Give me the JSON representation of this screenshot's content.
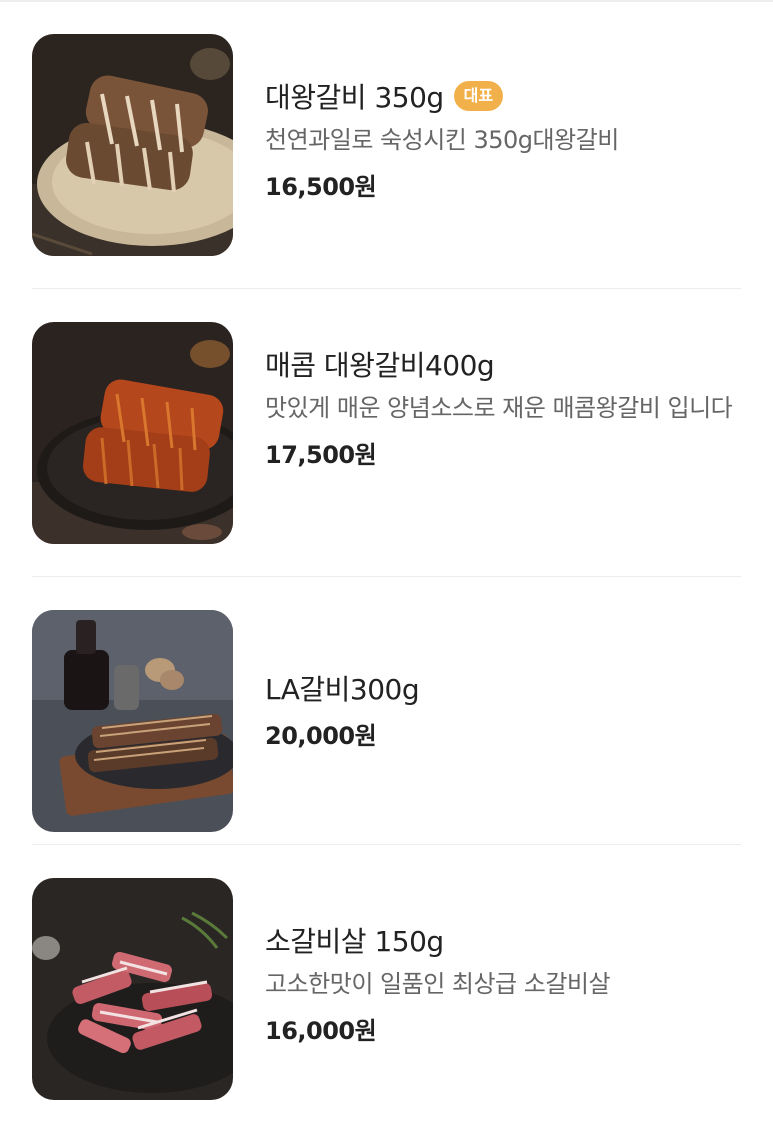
{
  "menu": {
    "items": [
      {
        "name": "대왕갈비 350g",
        "badge": "대표",
        "description": "천연과일로 숙성시킨 350g대왕갈비",
        "price": "16,500원",
        "image_icon": "galbi-plate-image"
      },
      {
        "name": "매콤 대왕갈비400g",
        "badge": "",
        "description": "맛있게 매운 양념소스로 재운 매콤왕갈비 입니다",
        "price": "17,500원",
        "image_icon": "spicy-galbi-plate-image"
      },
      {
        "name": "LA갈비300g",
        "badge": "",
        "description": "",
        "price": "20,000원",
        "image_icon": "la-galbi-board-image"
      },
      {
        "name": "소갈비살 150g",
        "badge": "",
        "description": "고소한맛이 일품인 최상급 소갈비살",
        "price": "16,000원",
        "image_icon": "raw-rib-meat-image"
      }
    ]
  },
  "colors": {
    "badge": "#f2b04b",
    "divider": "#ececec",
    "text_primary": "#222222",
    "text_secondary": "#666666"
  }
}
